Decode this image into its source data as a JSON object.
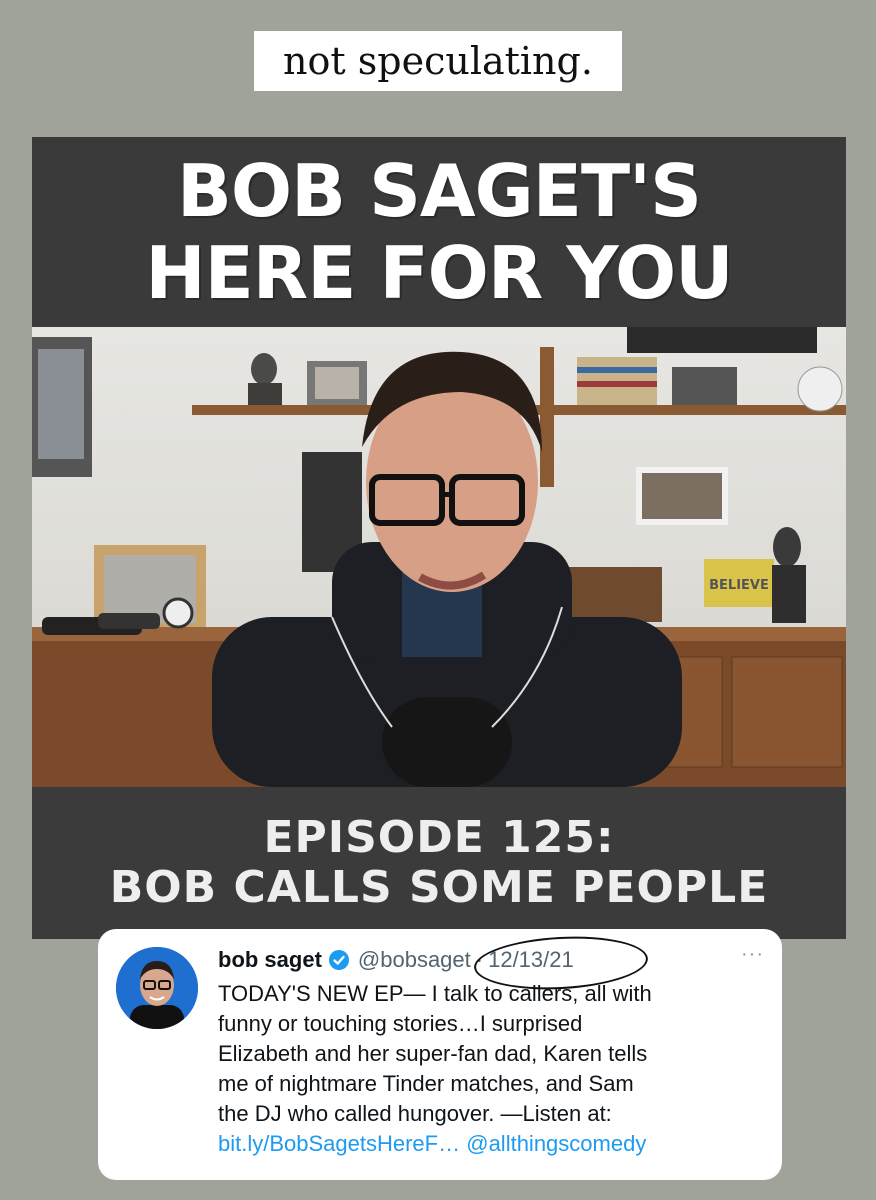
{
  "caption": "not speculating.",
  "video": {
    "title_lines": [
      "BOB SAGET'S",
      "HERE FOR YOU"
    ],
    "episode_lines": [
      "EPISODE 125:",
      "BOB CALLS SOME PEOPLE"
    ],
    "sign_text": "BELIEVE"
  },
  "tweet": {
    "name": "bob saget",
    "handle": "@bobsaget",
    "separator": "·",
    "date": "12/13/21",
    "more": "···",
    "body_lines": [
      "TODAY'S NEW EP— I talk to callers, all with",
      "funny or touching stories…I surprised",
      "Elizabeth and her super-fan dad, Karen tells",
      "me of nightmare Tinder matches, and Sam",
      "the DJ who called hungover. —Listen at:"
    ],
    "link": "bit.ly/BobSagetsHereF…",
    "mention": "@allthingscomedy",
    "colors": {
      "link": "#1d9bf0",
      "verified": "#1d9bf0",
      "secondary_text": "#536471"
    }
  }
}
